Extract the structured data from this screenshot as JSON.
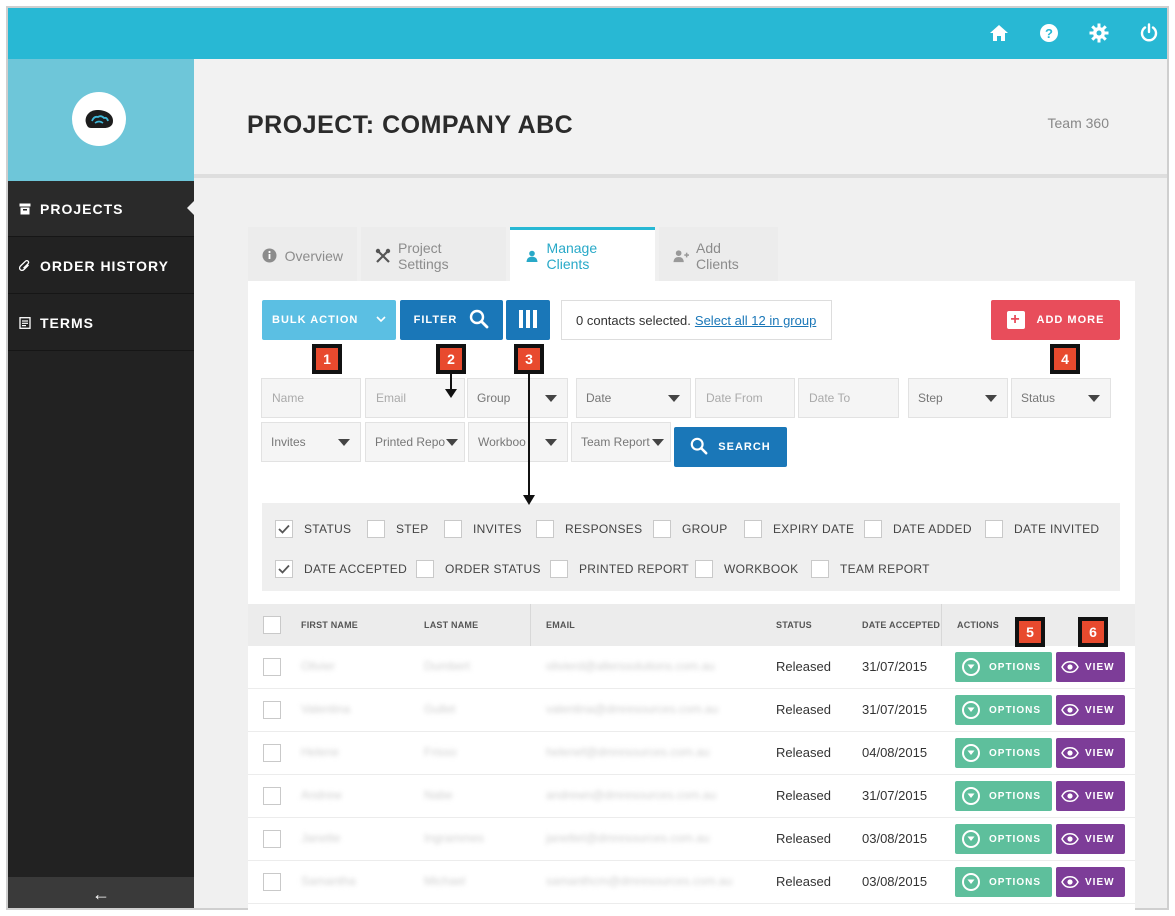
{
  "topbar": {
    "icons": [
      "home-icon",
      "help-icon",
      "gear-icon",
      "power-icon"
    ],
    "color": "#28b8d4"
  },
  "sidebar": {
    "items": [
      {
        "label": "PROJECTS",
        "icon": "archive-icon",
        "active": true
      },
      {
        "label": "ORDER HISTORY",
        "icon": "paperclip-icon",
        "active": false
      },
      {
        "label": "TERMS",
        "icon": "document-icon",
        "active": false
      }
    ],
    "collapse": "←"
  },
  "header": {
    "title": "PROJECT: COMPANY ABC",
    "team": "Team 360"
  },
  "tabs": [
    {
      "label": "Overview",
      "icon": "info-icon"
    },
    {
      "label": "Project Settings",
      "icon": "tools-icon"
    },
    {
      "label": "Manage Clients",
      "icon": "user-icon"
    },
    {
      "label": "Add Clients",
      "icon": "add-user-icon"
    }
  ],
  "toolbar": {
    "bulk_action": "BULK ACTION",
    "filter": "FILTER",
    "selected_text": "0 contacts selected.",
    "select_all": "Select all 12 in group",
    "add_more": "ADD MORE"
  },
  "markers": [
    "1",
    "2",
    "3",
    "4",
    "5",
    "6"
  ],
  "filters": {
    "name_ph": "Name",
    "email_ph": "Email",
    "group": "Group",
    "date": "Date",
    "date_from_ph": "Date From",
    "date_to_ph": "Date To",
    "step": "Step",
    "status": "Status",
    "invites": "Invites",
    "printed_report": "Printed Repo",
    "workbook": "Workboo",
    "team_report": "Team Report",
    "search": "SEARCH"
  },
  "columns": [
    {
      "label": "STATUS",
      "checked": true
    },
    {
      "label": "STEP",
      "checked": false
    },
    {
      "label": "INVITES",
      "checked": false
    },
    {
      "label": "RESPONSES",
      "checked": false
    },
    {
      "label": "GROUP",
      "checked": false
    },
    {
      "label": "EXPIRY DATE",
      "checked": false
    },
    {
      "label": "DATE ADDED",
      "checked": false
    },
    {
      "label": "DATE INVITED",
      "checked": false
    },
    {
      "label": "DATE ACCEPTED",
      "checked": true
    },
    {
      "label": "ORDER STATUS",
      "checked": false
    },
    {
      "label": "PRINTED REPORT",
      "checked": false
    },
    {
      "label": "WORKBOOK",
      "checked": false
    },
    {
      "label": "TEAM REPORT",
      "checked": false
    }
  ],
  "table": {
    "headers": [
      "FIRST NAME",
      "LAST NAME",
      "EMAIL",
      "STATUS",
      "DATE ACCEPTED",
      "ACTIONS"
    ],
    "options_label": "OPTIONS",
    "view_label": "VIEW",
    "rows": [
      {
        "first": "Olivier",
        "last": "Dumbert",
        "email": "olivierd@allerssolutions.com.au",
        "status": "Released",
        "date": "31/07/2015"
      },
      {
        "first": "Valentina",
        "last": "Gullet",
        "email": "valentina@dmresources.com.au",
        "status": "Released",
        "date": "31/07/2015"
      },
      {
        "first": "Helene",
        "last": "Frisso",
        "email": "helenef@dmresources.com.au",
        "status": "Released",
        "date": "04/08/2015"
      },
      {
        "first": "Andrew",
        "last": "Nabe",
        "email": "andrewn@dmresources.com.au",
        "status": "Released",
        "date": "31/07/2015"
      },
      {
        "first": "Janette",
        "last": "Ingrammes",
        "email": "janetteI@dmresources.com.au",
        "status": "Released",
        "date": "03/08/2015"
      },
      {
        "first": "Samantha",
        "last": "Michael",
        "email": "samanthcm@dmresources.com.au",
        "status": "Released",
        "date": "03/08/2015"
      }
    ]
  }
}
